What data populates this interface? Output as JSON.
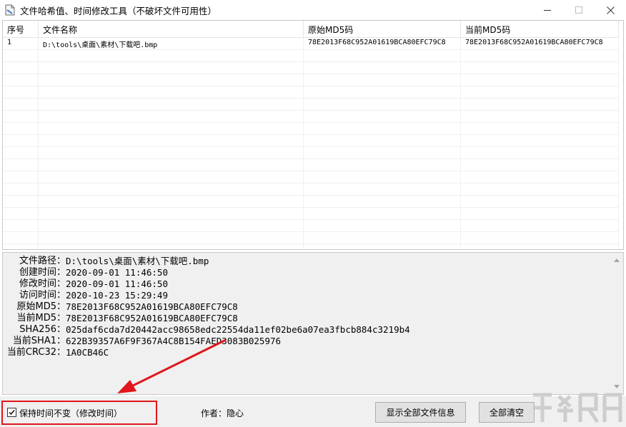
{
  "window": {
    "title": "文件哈希值、时间修改工具（不破坏文件可用性）"
  },
  "list": {
    "columns": [
      "序号",
      "文件名称",
      "原始MD5码",
      "当前MD5码"
    ],
    "rows": [
      [
        "1",
        "D:\\tools\\桌面\\素材\\下载吧.bmp",
        "78E2013F68C952A01619BCA80EFC79C8",
        "78E2013F68C952A01619BCA80EFC79C8"
      ]
    ]
  },
  "info": {
    "lines": [
      {
        "label": "文件路径：",
        "value": "D:\\tools\\桌面\\素材\\下载吧.bmp"
      },
      {
        "label": "创建时间：",
        "value": "2020-09-01 11:46:50"
      },
      {
        "label": "修改时间：",
        "value": "2020-09-01 11:46:50"
      },
      {
        "label": "访问时间：",
        "value": "2020-10-23 15:29:49"
      },
      {
        "label": "原始MD5：",
        "value": "78E2013F68C952A01619BCA80EFC79C8"
      },
      {
        "label": "当前MD5：",
        "value": "78E2013F68C952A01619BCA80EFC79C8"
      },
      {
        "label": "SHA256：",
        "value": "025daf6cda7d20442acc98658edc22554da11ef02be6a07ea3fbcb884c3219b4"
      },
      {
        "label": "当前SHA1：",
        "value": "622B39357A6F9F367A4C8B154FAED3083B025976"
      },
      {
        "label": "当前CRC32：",
        "value": "1A0CB46C"
      }
    ]
  },
  "bottom": {
    "keep_time_label": "保持时间不变（修改时间）",
    "keep_time_checked": true,
    "author": "作者：隐心",
    "show_all_button": "显示全部文件信息",
    "clear_all_button": "全部清空"
  },
  "colors": {
    "highlight_red": "#e0161b"
  }
}
